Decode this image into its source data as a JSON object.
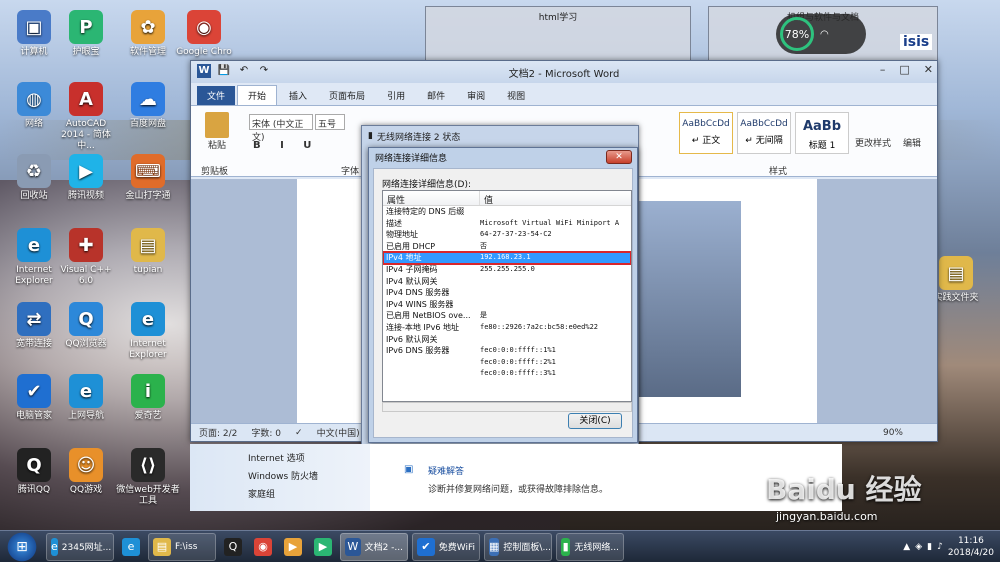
{
  "desktop_icons": [
    {
      "label": "计算机",
      "color": "#4a7bc8",
      "glyph": "▣"
    },
    {
      "label": "护眼宝",
      "color": "#2bb673",
      "glyph": "P"
    },
    {
      "label": "软件管理",
      "color": "#e8a33a",
      "glyph": "✿"
    },
    {
      "label": "Google Chro",
      "color": "#db4437",
      "glyph": "◉"
    },
    {
      "label": "网络",
      "color": "#3c8ad8",
      "glyph": "◍"
    },
    {
      "label": "AutoCAD 2014 - 简体中...",
      "color": "#c8302c",
      "glyph": "A"
    },
    {
      "label": "百度网盘",
      "color": "#2f7de1",
      "glyph": "☁"
    },
    {
      "label": "回收站",
      "color": "#8a9bb3",
      "glyph": "♻"
    },
    {
      "label": "腾讯视频",
      "color": "#1fb3e8",
      "glyph": "▶"
    },
    {
      "label": "金山打字通",
      "color": "#e06c2a",
      "glyph": "⌨"
    },
    {
      "label": "Internet Explorer",
      "color": "#1e90d6",
      "glyph": "e"
    },
    {
      "label": "Visual C++ 6.0",
      "color": "#b8332a",
      "glyph": "✚"
    },
    {
      "label": "tupian",
      "color": "#e0b84a",
      "glyph": "▤"
    },
    {
      "label": "宽带连接",
      "color": "#2f6fbf",
      "glyph": "⇄"
    },
    {
      "label": "QQ浏览器",
      "color": "#2c88d9",
      "glyph": "Q"
    },
    {
      "label": "Internet Explorer",
      "color": "#1e90d6",
      "glyph": "e"
    },
    {
      "label": "电脑管家",
      "color": "#1f6fd1",
      "glyph": "✔"
    },
    {
      "label": "上网导航",
      "color": "#1e90d6",
      "glyph": "e"
    },
    {
      "label": "爱奇艺",
      "color": "#2bb24c",
      "glyph": "i"
    },
    {
      "label": "腾讯QQ",
      "color": "#222222",
      "glyph": "Q"
    },
    {
      "label": "QQ游戏",
      "color": "#e8902a",
      "glyph": "☺"
    },
    {
      "label": "微信web开发者工具",
      "color": "#2a2a2a",
      "glyph": "⟨⟩"
    },
    {
      "label": "实践文件夹",
      "color": "#e0b84a",
      "glyph": "▤"
    }
  ],
  "bg_windows": {
    "left_title": "html学习",
    "right_title": "机组与软件与文档",
    "right_logo": "isis"
  },
  "gauge": {
    "percent": "78%"
  },
  "word": {
    "title": "文档2 - Microsoft Word",
    "tabs": [
      "文件",
      "开始",
      "插入",
      "页面布局",
      "引用",
      "邮件",
      "审阅",
      "视图"
    ],
    "font_name": "宋体 (中文正文)",
    "font_size": "五号",
    "paste_label": "粘贴",
    "clipboard_label": "剪贴板",
    "font_group_label": "字体",
    "styles_label": "样式",
    "styles": [
      {
        "preview": "AaBbCcDd",
        "name": "↵ 正文"
      },
      {
        "preview": "AaBbCcDd",
        "name": "↵ 无间隔"
      },
      {
        "preview": "AaBb",
        "name": "标题 1"
      }
    ],
    "change_styles": "更改样式",
    "edit_label": "编辑",
    "status": {
      "page": "页面: 2/2",
      "words": "字数: 0",
      "lang": "中文(中国)",
      "insert": "插入",
      "zoom": "90%"
    }
  },
  "netstatus": {
    "title": "无线网络连接 2 状态"
  },
  "details": {
    "title": "网络连接详细信息",
    "list_label": "网络连接详细信息(D):",
    "col_property": "属性",
    "col_value": "值",
    "rows": [
      {
        "p": "连接特定的 DNS 后缀",
        "v": ""
      },
      {
        "p": "描述",
        "v": "Microsoft Virtual WiFi Miniport A"
      },
      {
        "p": "物理地址",
        "v": "64-27-37-23-54-C2"
      },
      {
        "p": "已启用 DHCP",
        "v": "否"
      },
      {
        "p": "IPv4 地址",
        "v": "192.168.23.1"
      },
      {
        "p": "IPv4 子网掩码",
        "v": "255.255.255.0"
      },
      {
        "p": "IPv4 默认网关",
        "v": ""
      },
      {
        "p": "IPv4 DNS 服务器",
        "v": ""
      },
      {
        "p": "IPv4 WINS 服务器",
        "v": ""
      },
      {
        "p": "已启用 NetBIOS ove...",
        "v": "是"
      },
      {
        "p": "连接-本地 IPv6 地址",
        "v": "fe80::2926:7a2c:bc58:e0ed%22"
      },
      {
        "p": "IPv6 默认网关",
        "v": ""
      },
      {
        "p": "IPv6 DNS 服务器",
        "v": "fec0:0:0:ffff::1%1"
      },
      {
        "p": "",
        "v": "fec0:0:0:ffff::2%1"
      },
      {
        "p": "",
        "v": "fec0:0:0:ffff::3%1"
      }
    ],
    "selected_index": 4,
    "close_button": "关闭(C)"
  },
  "cpanel": {
    "links": [
      "Internet 选项",
      "Windows 防火墙",
      "家庭组"
    ],
    "trouble_title": "疑难解答",
    "trouble_desc": "诊断并修复网络问题，或获得故障排除信息。"
  },
  "taskbar": {
    "items": [
      {
        "label": "2345网址...",
        "color": "#1e90d6",
        "glyph": "e",
        "task": true
      },
      {
        "label": "",
        "color": "#1e90d6",
        "glyph": "e",
        "task": false
      },
      {
        "label": "F:\\iss",
        "color": "#e0b84a",
        "glyph": "▤",
        "task": true
      },
      {
        "label": "",
        "color": "#222",
        "glyph": "Q",
        "task": false
      },
      {
        "label": "",
        "color": "#db4437",
        "glyph": "◉",
        "task": false
      },
      {
        "label": "",
        "color": "#e8a33a",
        "glyph": "▶",
        "task": false
      },
      {
        "label": "",
        "color": "#2bb673",
        "glyph": "▶",
        "task": false
      },
      {
        "label": "文档2 -...",
        "color": "#2b5797",
        "glyph": "W",
        "task": true
      },
      {
        "label": "免费WiFi",
        "color": "#1f6fd1",
        "glyph": "✔",
        "task": true
      },
      {
        "label": "控制面板\\...",
        "color": "#3c6fb5",
        "glyph": "▦",
        "task": true
      },
      {
        "label": "无线网络...",
        "color": "#2bb24c",
        "glyph": "▮",
        "task": true
      }
    ],
    "time": "11:16",
    "date": "2018/4/20"
  },
  "watermark": {
    "brand": "Baidu 经验",
    "url": "jingyan.baidu.com"
  }
}
